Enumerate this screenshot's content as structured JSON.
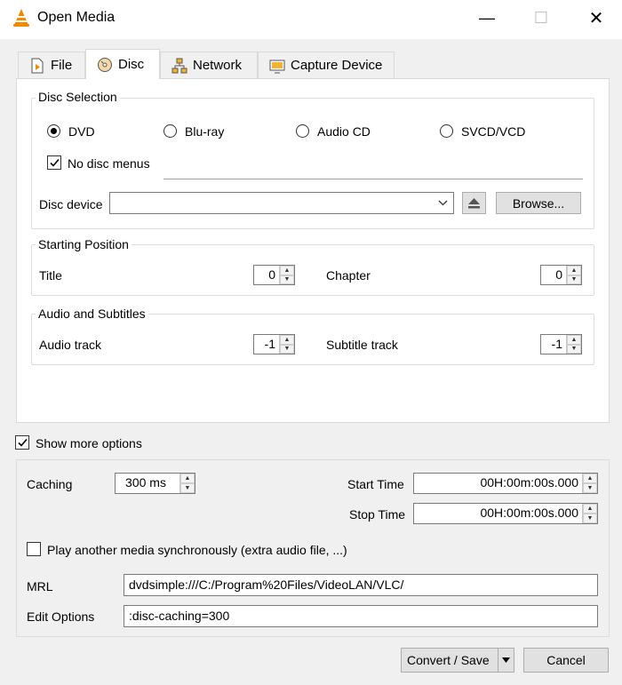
{
  "window": {
    "title": "Open Media",
    "minimize_icon": "—",
    "maximize_icon": "☐",
    "close_icon": "✕"
  },
  "tabs": [
    {
      "label": "File",
      "icon": "file-icon",
      "active": false
    },
    {
      "label": "Disc",
      "icon": "disc-icon",
      "active": true
    },
    {
      "label": "Network",
      "icon": "network-icon",
      "active": false
    },
    {
      "label": "Capture Device",
      "icon": "capture-device-icon",
      "active": false
    }
  ],
  "disc_selection": {
    "title": "Disc Selection",
    "options": [
      {
        "label": "DVD",
        "selected": true
      },
      {
        "label": "Blu-ray",
        "selected": false
      },
      {
        "label": "Audio CD",
        "selected": false
      },
      {
        "label": "SVCD/VCD",
        "selected": false
      }
    ],
    "no_disc_menus": {
      "label": "No disc menus",
      "checked": true
    },
    "disc_device": {
      "label": "Disc device",
      "value": ""
    },
    "browse_label": "Browse..."
  },
  "starting_position": {
    "title": "Starting Position",
    "title_label": "Title",
    "title_value": "0",
    "chapter_label": "Chapter",
    "chapter_value": "0"
  },
  "audio_subtitles": {
    "title": "Audio and Subtitles",
    "audio_label": "Audio track",
    "audio_value": "-1",
    "subtitle_label": "Subtitle track",
    "subtitle_value": "-1"
  },
  "more_options": {
    "show_label": "Show more options",
    "checked": true,
    "caching_label": "Caching",
    "caching_value": "300 ms",
    "start_time_label": "Start Time",
    "start_time_value": "00H:00m:00s.000",
    "stop_time_label": "Stop Time",
    "stop_time_value": "00H:00m:00s.000",
    "play_another_label": "Play another media synchronously (extra audio file, ...)",
    "play_another_checked": false,
    "mrl_label": "MRL",
    "mrl_value": "dvdsimple:///C:/Program%20Files/VideoLAN/VLC/",
    "edit_options_label": "Edit Options",
    "edit_options_value": ":disc-caching=300"
  },
  "footer": {
    "convert_save_label": "Convert / Save",
    "cancel_label": "Cancel"
  },
  "colors": {
    "vlc_orange": "#f28a00",
    "window_bg": "#f0f0f0",
    "panel_bg": "#ffffff"
  }
}
